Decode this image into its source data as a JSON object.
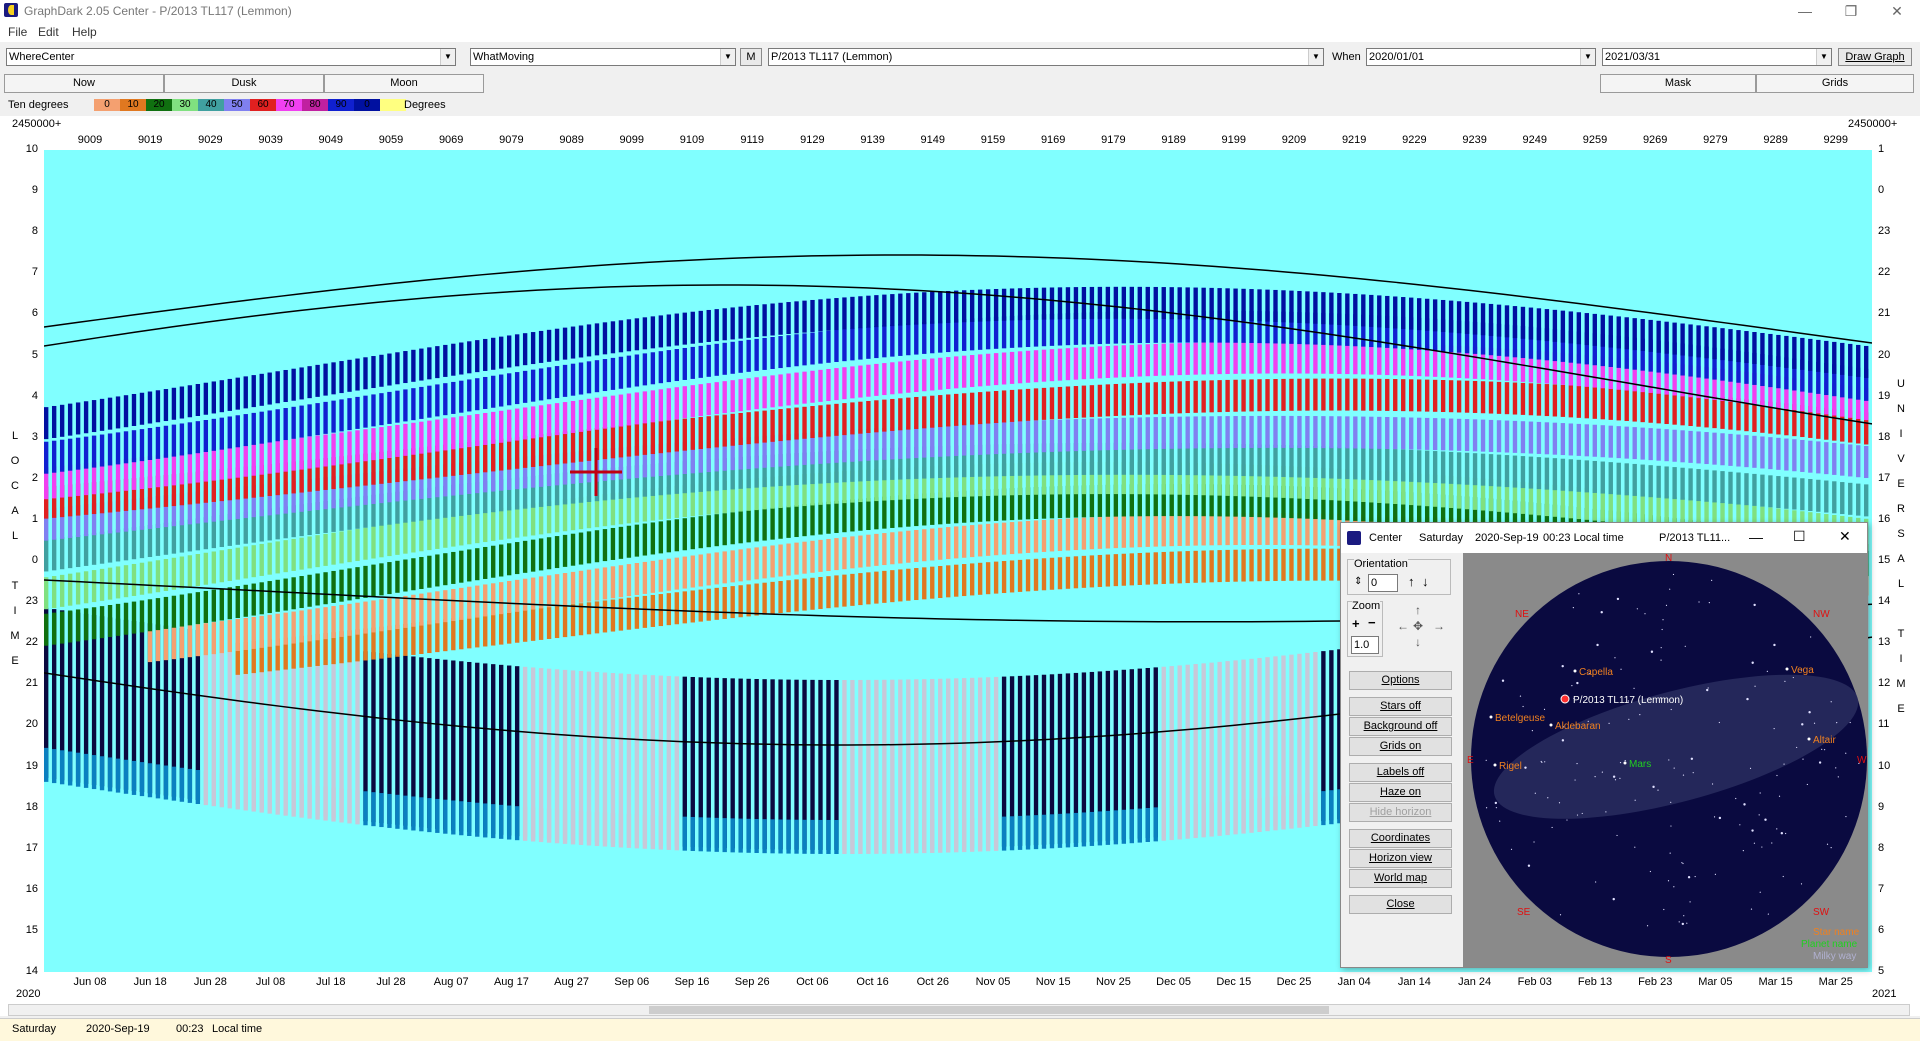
{
  "window": {
    "title": "GraphDark 2.05  Center  -  P/2013 TL117 (Lemmon)"
  },
  "menu": [
    "File",
    "Edit",
    "Help"
  ],
  "toolbar": {
    "where_label": "Where",
    "where_value": "Center",
    "what_label": "What",
    "what_value": "Moving",
    "m_button": "M",
    "object_value": "P/2013 TL117 (Lemmon)",
    "when_label": "When",
    "start_date": "2020/01/01",
    "end_date": "2021/03/31",
    "draw_button": "Draw Graph"
  },
  "tabs": {
    "left": [
      "Now",
      "Dusk",
      "Moon"
    ],
    "right": [
      "Mask",
      "Grids"
    ]
  },
  "legend": {
    "label": "Ten degrees",
    "units": "Degrees",
    "steps": [
      {
        "value": "0",
        "color": "#f4a070"
      },
      {
        "value": "10",
        "color": "#e07820"
      },
      {
        "value": "20",
        "color": "#107010"
      },
      {
        "value": "30",
        "color": "#80e080"
      },
      {
        "value": "40",
        "color": "#40a0a0"
      },
      {
        "value": "50",
        "color": "#8080f0"
      },
      {
        "value": "60",
        "color": "#e02020"
      },
      {
        "value": "70",
        "color": "#f040f0"
      },
      {
        "value": "80",
        "color": "#c020a0"
      },
      {
        "value": "90",
        "color": "#1020d0"
      },
      {
        "value": "0",
        "color": "#0010a0"
      },
      {
        "value": "",
        "color": "#ffff80"
      }
    ]
  },
  "graph": {
    "jd_label_left": "2450000+",
    "jd_label_right": "2450000+",
    "jd_ticks": [
      "9009",
      "9019",
      "9029",
      "9039",
      "9049",
      "9059",
      "9069",
      "9079",
      "9089",
      "9099",
      "9109",
      "9119",
      "9129",
      "9139",
      "9149",
      "9159",
      "9169",
      "9179",
      "9189",
      "9199",
      "9209",
      "9219",
      "9229",
      "9239",
      "9249",
      "9259",
      "9269",
      "9279",
      "9289",
      "9299"
    ],
    "left_axis": [
      "10",
      "9",
      "8",
      "7",
      "6",
      "5",
      "4",
      "3",
      "2",
      "1",
      "0",
      "23",
      "22",
      "21",
      "20",
      "19",
      "18",
      "17",
      "16",
      "15",
      "14"
    ],
    "right_axis": [
      "1",
      "0",
      "23",
      "22",
      "21",
      "20",
      "19",
      "18",
      "17",
      "16",
      "15",
      "14",
      "13",
      "12",
      "11",
      "10",
      "9",
      "8",
      "7",
      "6",
      "5"
    ],
    "left_vertical": [
      "L",
      "O",
      "C",
      "A",
      "L",
      "",
      "T",
      "I",
      "M",
      "E"
    ],
    "right_vertical": [
      "U",
      "N",
      "I",
      "V",
      "E",
      "R",
      "S",
      "A",
      "L",
      "",
      "T",
      "I",
      "M",
      "E"
    ],
    "date_ticks": [
      "Jun 08",
      "Jun 18",
      "Jun 28",
      "Jul 08",
      "Jul 18",
      "Jul 28",
      "Aug 07",
      "Aug 17",
      "Aug 27",
      "Sep 06",
      "Sep 16",
      "Sep 26",
      "Oct 06",
      "Oct 16",
      "Oct 26",
      "Nov 05",
      "Nov 15",
      "Nov 25",
      "Dec 05",
      "Dec 15",
      "Dec 25",
      "Jan 04",
      "Jan 14",
      "Jan 24",
      "Feb 03",
      "Feb 13",
      "Feb 23",
      "Mar 05",
      "Mar 15",
      "Mar 25"
    ],
    "year_left": "2020",
    "year_right": "2021",
    "colors": {
      "background": "#80ffff",
      "night": "#0a0a40",
      "twilight": "#c8c8d8",
      "dusk": "#0a80c0"
    }
  },
  "status": {
    "day": "Saturday",
    "date": "2020-Sep-19",
    "time": "00:23",
    "suffix": "Local time"
  },
  "skyview": {
    "title_app": "Center",
    "title_day": "Saturday",
    "title_date": "2020-Sep-19",
    "title_time": "00:23 Local time",
    "title_obj": "P/2013 TL11...",
    "orientation_label": "Orientation",
    "orientation_value": "0",
    "zoom_label": "Zoom",
    "zoom_value": "1.0",
    "buttons": [
      "Options",
      "Stars off",
      "Background off",
      "Grids on",
      "Labels off",
      "Haze on",
      "Hide horizon",
      "Coordinates",
      "Horizon view",
      "World map",
      "Close"
    ],
    "compass": [
      "N",
      "NE",
      "NW",
      "E",
      "W",
      "SE",
      "SW",
      "S"
    ],
    "stars": [
      "Capella",
      "Vega",
      "Betelgeuse",
      "Aldebaran",
      "Altair",
      "Rigel",
      "Mars"
    ],
    "target": "P/2013 TL117 (Lemmon)",
    "legend": [
      "Star name",
      "Planet name",
      "Milky way"
    ],
    "colors": {
      "star": "#f08020",
      "planet": "#20d020",
      "compass": "#e01010",
      "sky": "#0a0a40"
    }
  }
}
